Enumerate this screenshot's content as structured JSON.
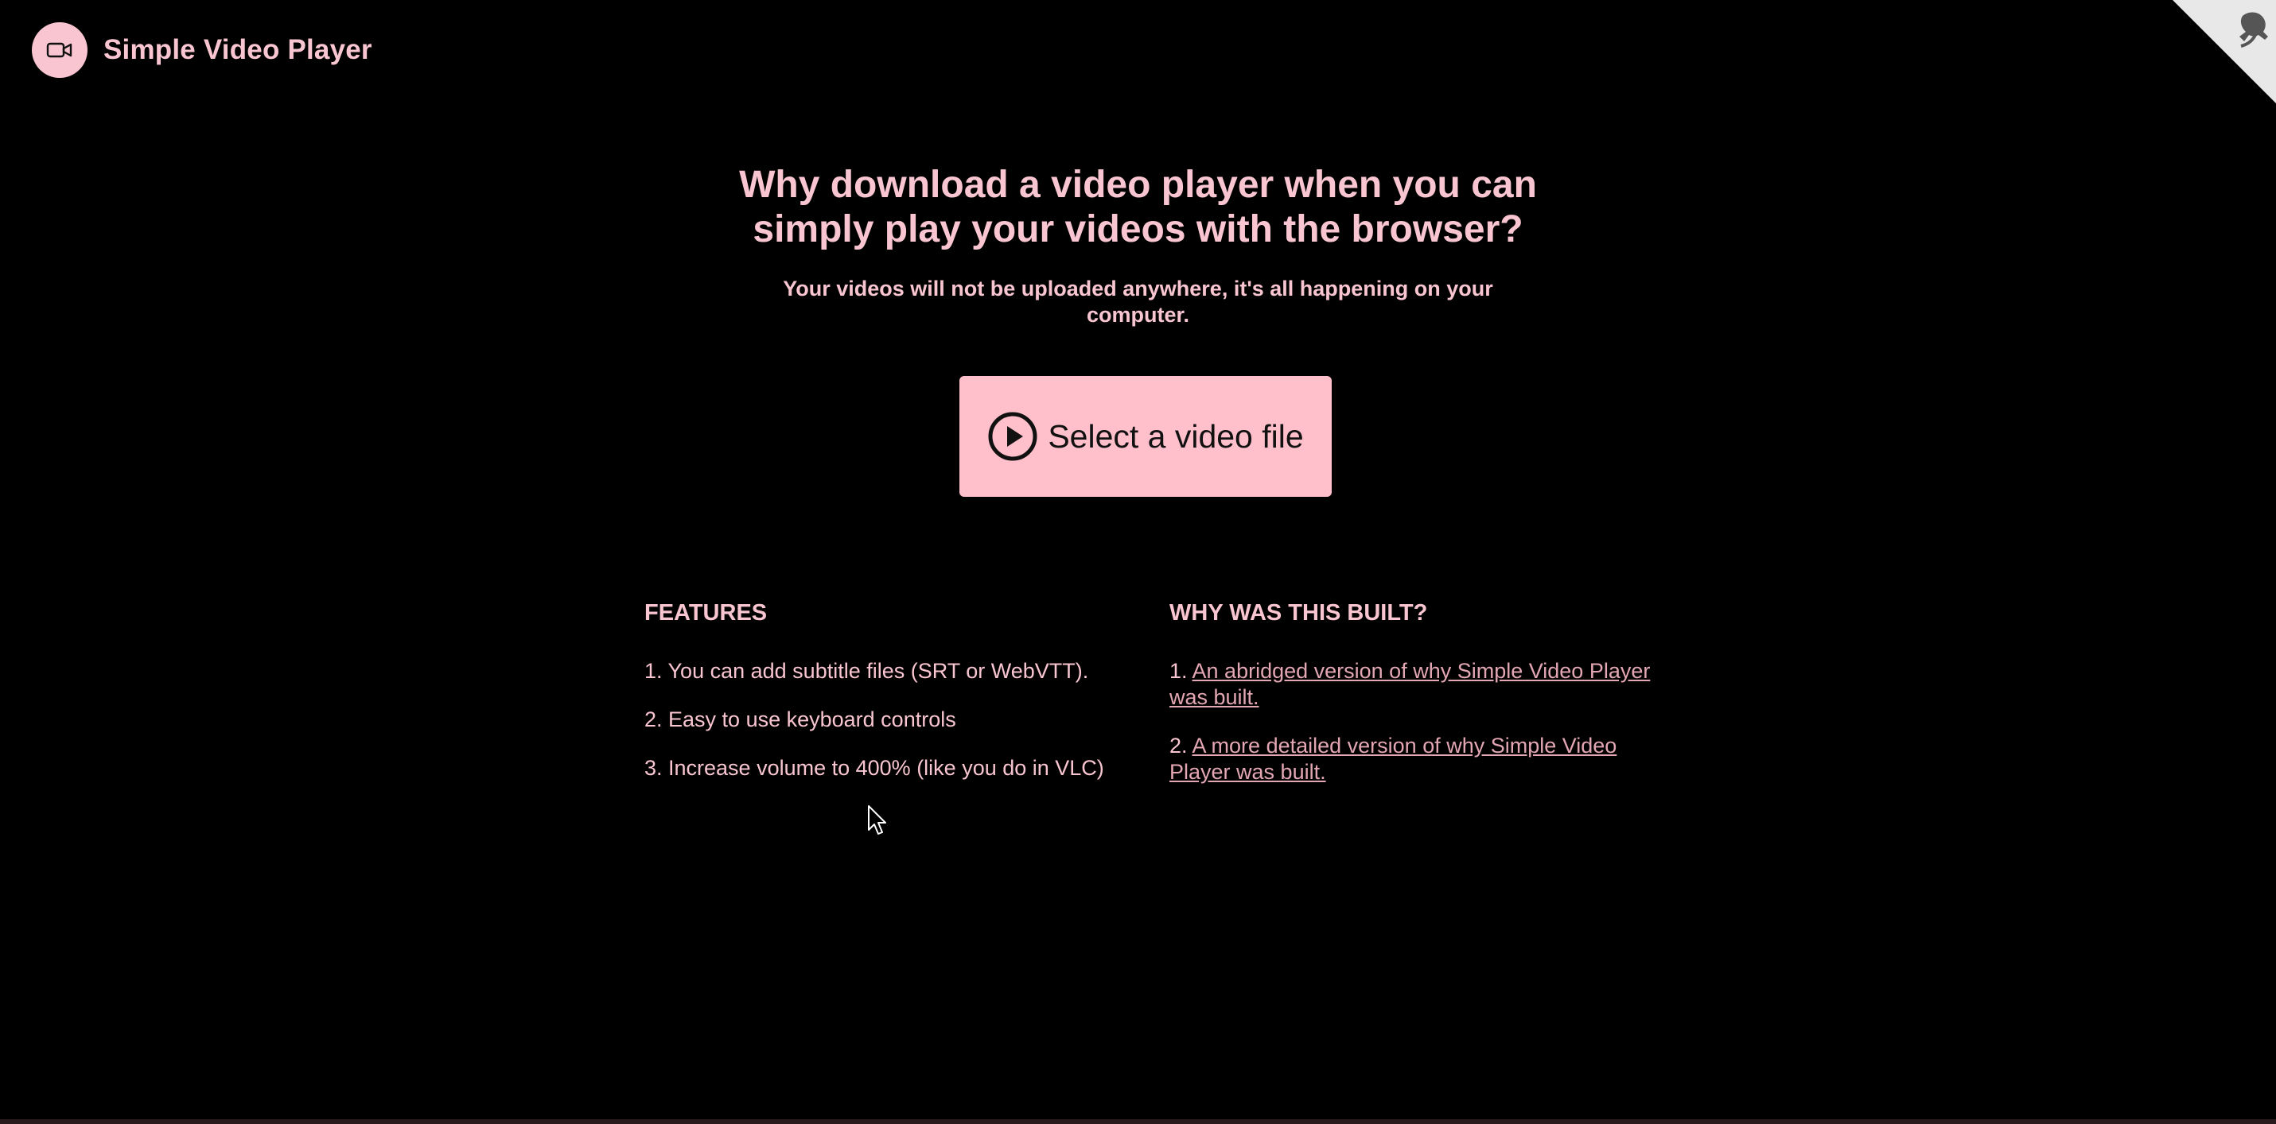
{
  "header": {
    "logo_icon": "video-camera-icon",
    "title": "Simple Video Player"
  },
  "github_corner": {
    "icon": "github-octocat-icon"
  },
  "hero": {
    "headline": "Why download a video player when you can simply play your videos with the browser?",
    "subline": "Your videos will not be uploaded anywhere, it's all happening on your computer.",
    "select_button_label": "Select a video file",
    "select_button_icon": "play-circle-icon"
  },
  "features": {
    "title": "FEATURES",
    "items": [
      "1. You can add subtitle files (SRT or WebVTT).",
      "2. Easy to use keyboard controls",
      "3. Increase volume to 400% (like you do in VLC)"
    ]
  },
  "why": {
    "title": "WHY WAS THIS BUILT?",
    "items": [
      {
        "prefix": "1. ",
        "link_text": "An abridged version of why Simple Video Player was built."
      },
      {
        "prefix": "2. ",
        "link_text": "A more detailed version of why Simple Video Player was built."
      }
    ]
  },
  "colors": {
    "background": "#000000",
    "accent": "#f8c5d0",
    "button_bg": "#ffc0cb",
    "link": "#e3a7b4"
  }
}
